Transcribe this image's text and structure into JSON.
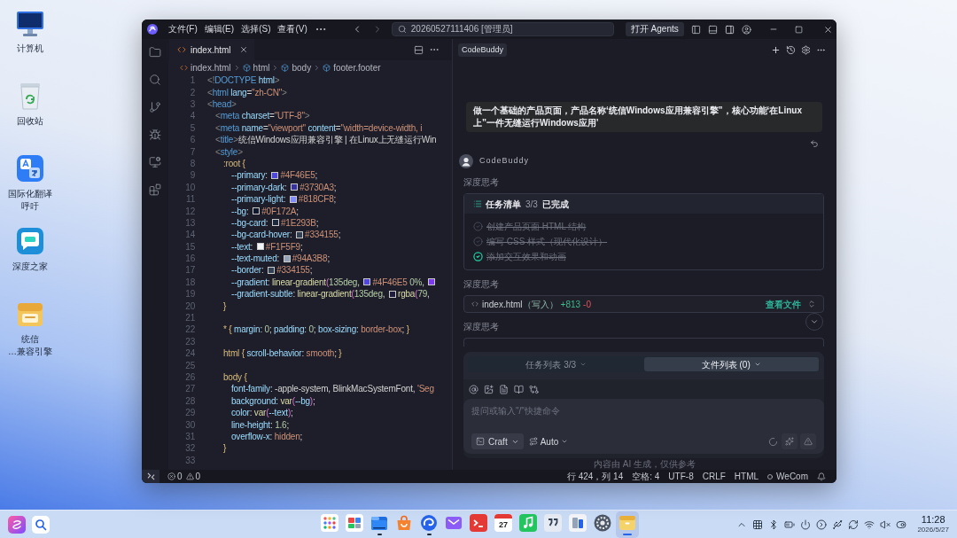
{
  "desktop_icons": [
    {
      "kind": "computer",
      "label_lines": [
        "计算机"
      ]
    },
    {
      "kind": "trash",
      "label_lines": [
        "回收站"
      ]
    },
    {
      "kind": "translator",
      "label_lines": [
        "国际化翻译",
        "呼吁"
      ]
    },
    {
      "kind": "home",
      "label_lines": [
        "深度之家"
      ]
    },
    {
      "kind": "package",
      "label_lines": [
        "统信",
        "…兼容引擎"
      ]
    }
  ],
  "window": {
    "menu": [
      "文件(F)",
      "编辑(E)",
      "选择(S)",
      "查看(V)"
    ],
    "command_center": "20260527111406 [管理员]",
    "agents_button": "打开 Agents"
  },
  "editor": {
    "tabs": [
      {
        "label": "index.html",
        "selected": true
      }
    ],
    "breadcrumb": [
      {
        "kind": "file",
        "label": "index.html"
      },
      {
        "kind": "symbol",
        "label": "html"
      },
      {
        "kind": "symbol",
        "label": "body"
      },
      {
        "kind": "symbol",
        "label": "footer.footer"
      }
    ],
    "lines": [
      {
        "number": "1",
        "tokens": [
          {
            "kind": "punct",
            "text": "<!"
          },
          {
            "kind": "tag",
            "text": "DOCTYPE"
          },
          {
            "kind": "attr",
            "text": " html"
          },
          {
            "kind": "punct",
            "text": ">"
          }
        ]
      },
      {
        "number": "2",
        "tokens": [
          {
            "kind": "punct",
            "text": "<"
          },
          {
            "kind": "tag",
            "text": "html"
          },
          {
            "kind": "attr",
            "text": " lang"
          },
          {
            "kind": "plain",
            "text": "="
          },
          {
            "kind": "string",
            "text": "\"zh-CN\""
          },
          {
            "kind": "punct",
            "text": ">"
          }
        ]
      },
      {
        "number": "3",
        "tokens": [
          {
            "kind": "punct",
            "text": "<"
          },
          {
            "kind": "tag",
            "text": "head"
          },
          {
            "kind": "punct",
            "text": ">"
          }
        ],
        "children": [
          {
            "number": "4",
            "tokens": [
              {
                "kind": "punct",
                "text": "<"
              },
              {
                "kind": "tag",
                "text": "meta"
              },
              {
                "kind": "attr",
                "text": " charset"
              },
              {
                "kind": "plain",
                "text": "="
              },
              {
                "kind": "string",
                "text": "\"UTF-8\""
              },
              {
                "kind": "punct",
                "text": ">"
              }
            ]
          },
          {
            "number": "5",
            "tokens": [
              {
                "kind": "punct",
                "text": "<"
              },
              {
                "kind": "tag",
                "text": "meta"
              },
              {
                "kind": "attr",
                "text": " name"
              },
              {
                "kind": "plain",
                "text": "="
              },
              {
                "kind": "string",
                "text": "\"viewport\""
              },
              {
                "kind": "attr",
                "text": " content"
              },
              {
                "kind": "plain",
                "text": "="
              },
              {
                "kind": "string",
                "text": "\"width=device-width, i"
              }
            ]
          },
          {
            "number": "6",
            "tokens": [
              {
                "kind": "punct",
                "text": "<"
              },
              {
                "kind": "tag",
                "text": "title"
              },
              {
                "kind": "punct",
                "text": ">"
              },
              {
                "kind": "plain",
                "text": "统信Windows应用兼容引擎 | 在Linux上无缝运行Win"
              }
            ]
          },
          {
            "number": "7",
            "tokens": [
              {
                "kind": "punct",
                "text": "<"
              },
              {
                "kind": "tag",
                "text": "style"
              },
              {
                "kind": "punct",
                "text": ">"
              }
            ],
            "children": [
              {
                "number": "8",
                "tokens": [
                  {
                    "kind": "selector",
                    "text": ":root"
                  },
                  {
                    "kind": "brace",
                    "text": " {"
                  }
                ],
                "children": [
                  {
                    "number": "9",
                    "tokens": [
                      {
                        "kind": "prop",
                        "text": "--primary"
                      },
                      {
                        "kind": "plain",
                        "text": ": "
                      },
                      {
                        "kind": "swatch",
                        "color": "#4f46e5"
                      },
                      {
                        "kind": "value",
                        "text": "#4F46E5"
                      },
                      {
                        "kind": "plain",
                        "text": ";"
                      }
                    ]
                  },
                  {
                    "number": "10",
                    "tokens": [
                      {
                        "kind": "prop",
                        "text": "--primary-dark"
                      },
                      {
                        "kind": "plain",
                        "text": ": "
                      },
                      {
                        "kind": "swatch",
                        "color": "#3730a3"
                      },
                      {
                        "kind": "value",
                        "text": "#3730A3"
                      },
                      {
                        "kind": "plain",
                        "text": ";"
                      }
                    ]
                  },
                  {
                    "number": "11",
                    "tokens": [
                      {
                        "kind": "prop",
                        "text": "--primary-light"
                      },
                      {
                        "kind": "plain",
                        "text": ": "
                      },
                      {
                        "kind": "swatch",
                        "color": "#818cf8"
                      },
                      {
                        "kind": "value",
                        "text": "#818CF8"
                      },
                      {
                        "kind": "plain",
                        "text": ";"
                      }
                    ]
                  },
                  {
                    "number": "12",
                    "tokens": [
                      {
                        "kind": "prop",
                        "text": "--bg"
                      },
                      {
                        "kind": "plain",
                        "text": ": "
                      },
                      {
                        "kind": "swatch",
                        "color": "#0f172a"
                      },
                      {
                        "kind": "value",
                        "text": "#0F172A"
                      },
                      {
                        "kind": "plain",
                        "text": ";"
                      }
                    ]
                  },
                  {
                    "number": "13",
                    "tokens": [
                      {
                        "kind": "prop",
                        "text": "--bg-card"
                      },
                      {
                        "kind": "plain",
                        "text": ": "
                      },
                      {
                        "kind": "swatch",
                        "color": "#1e293b"
                      },
                      {
                        "kind": "value",
                        "text": "#1E293B"
                      },
                      {
                        "kind": "plain",
                        "text": ";"
                      }
                    ]
                  },
                  {
                    "number": "14",
                    "tokens": [
                      {
                        "kind": "prop",
                        "text": "--bg-card-hover"
                      },
                      {
                        "kind": "plain",
                        "text": ": "
                      },
                      {
                        "kind": "swatch",
                        "color": "#334155"
                      },
                      {
                        "kind": "value",
                        "text": "#334155"
                      },
                      {
                        "kind": "plain",
                        "text": ";"
                      }
                    ]
                  },
                  {
                    "number": "15",
                    "tokens": [
                      {
                        "kind": "prop",
                        "text": "--text"
                      },
                      {
                        "kind": "plain",
                        "text": ": "
                      },
                      {
                        "kind": "swatch",
                        "color": "#f1f5f9"
                      },
                      {
                        "kind": "value",
                        "text": "#F1F5F9"
                      },
                      {
                        "kind": "plain",
                        "text": ";"
                      }
                    ]
                  },
                  {
                    "number": "16",
                    "tokens": [
                      {
                        "kind": "prop",
                        "text": "--text-muted"
                      },
                      {
                        "kind": "plain",
                        "text": ": "
                      },
                      {
                        "kind": "swatch",
                        "color": "#94a3b8"
                      },
                      {
                        "kind": "value",
                        "text": "#94A3B8"
                      },
                      {
                        "kind": "plain",
                        "text": ";"
                      }
                    ]
                  },
                  {
                    "number": "17",
                    "tokens": [
                      {
                        "kind": "prop",
                        "text": "--border"
                      },
                      {
                        "kind": "plain",
                        "text": ": "
                      },
                      {
                        "kind": "swatch",
                        "color": "#334155"
                      },
                      {
                        "kind": "value",
                        "text": "#334155"
                      },
                      {
                        "kind": "plain",
                        "text": ";"
                      }
                    ]
                  },
                  {
                    "number": "18",
                    "tokens": [
                      {
                        "kind": "prop",
                        "text": "--gradient"
                      },
                      {
                        "kind": "plain",
                        "text": ": "
                      },
                      {
                        "kind": "func",
                        "text": "linear-gradient"
                      },
                      {
                        "kind": "paren",
                        "text": "("
                      },
                      {
                        "kind": "number",
                        "text": "135deg"
                      },
                      {
                        "kind": "plain",
                        "text": ", "
                      },
                      {
                        "kind": "swatch",
                        "color": "#4f46e5"
                      },
                      {
                        "kind": "value",
                        "text": "#4F46E5"
                      },
                      {
                        "kind": "number",
                        "text": " 0%"
                      },
                      {
                        "kind": "plain",
                        "text": ", "
                      },
                      {
                        "kind": "swatch",
                        "color": "#7c3aed"
                      }
                    ]
                  },
                  {
                    "number": "19",
                    "tokens": [
                      {
                        "kind": "prop",
                        "text": "--gradient-subtle"
                      },
                      {
                        "kind": "plain",
                        "text": ": "
                      },
                      {
                        "kind": "func",
                        "text": "linear-gradient"
                      },
                      {
                        "kind": "paren",
                        "text": "("
                      },
                      {
                        "kind": "number",
                        "text": "135deg"
                      },
                      {
                        "kind": "plain",
                        "text": ", "
                      },
                      {
                        "kind": "swatch",
                        "color": "#1f1d3b"
                      },
                      {
                        "kind": "func",
                        "text": "rgba"
                      },
                      {
                        "kind": "paren",
                        "text": "("
                      },
                      {
                        "kind": "number",
                        "text": "79"
                      },
                      {
                        "kind": "plain",
                        "text": ","
                      }
                    ]
                  }
                ]
              },
              {
                "number": "20",
                "tokens": [
                  {
                    "kind": "brace",
                    "text": "}"
                  }
                ]
              },
              {
                "number": "21"
              },
              {
                "number": "22",
                "tokens": [
                  {
                    "kind": "selector",
                    "text": "*"
                  },
                  {
                    "kind": "brace",
                    "text": " {"
                  },
                  {
                    "kind": "prop",
                    "text": " margin"
                  },
                  {
                    "kind": "plain",
                    "text": ": "
                  },
                  {
                    "kind": "number",
                    "text": "0"
                  },
                  {
                    "kind": "plain",
                    "text": "; "
                  },
                  {
                    "kind": "prop",
                    "text": "padding"
                  },
                  {
                    "kind": "plain",
                    "text": ": "
                  },
                  {
                    "kind": "number",
                    "text": "0"
                  },
                  {
                    "kind": "plain",
                    "text": "; "
                  },
                  {
                    "kind": "prop",
                    "text": "box-sizing"
                  },
                  {
                    "kind": "plain",
                    "text": ": "
                  },
                  {
                    "kind": "value",
                    "text": "border-box"
                  },
                  {
                    "kind": "plain",
                    "text": "; "
                  },
                  {
                    "kind": "brace",
                    "text": "}"
                  }
                ]
              },
              {
                "number": "23"
              },
              {
                "number": "24",
                "tokens": [
                  {
                    "kind": "selector",
                    "text": "html"
                  },
                  {
                    "kind": "brace",
                    "text": " {"
                  },
                  {
                    "kind": "prop",
                    "text": " scroll-behavior"
                  },
                  {
                    "kind": "plain",
                    "text": ": "
                  },
                  {
                    "kind": "value",
                    "text": "smooth"
                  },
                  {
                    "kind": "plain",
                    "text": "; "
                  },
                  {
                    "kind": "brace",
                    "text": "}"
                  }
                ]
              },
              {
                "number": "25"
              },
              {
                "number": "26",
                "tokens": [
                  {
                    "kind": "selector",
                    "text": "body"
                  },
                  {
                    "kind": "brace",
                    "text": " {"
                  }
                ],
                "children": [
                  {
                    "number": "27",
                    "tokens": [
                      {
                        "kind": "prop",
                        "text": "font-family"
                      },
                      {
                        "kind": "plain",
                        "text": ": -apple-system, BlinkMacSystemFont, "
                      },
                      {
                        "kind": "string",
                        "text": "'Seg"
                      }
                    ]
                  },
                  {
                    "number": "28",
                    "tokens": [
                      {
                        "kind": "prop",
                        "text": "background"
                      },
                      {
                        "kind": "plain",
                        "text": ": "
                      },
                      {
                        "kind": "func",
                        "text": "var"
                      },
                      {
                        "kind": "paren",
                        "text": "("
                      },
                      {
                        "kind": "prop",
                        "text": "--bg"
                      },
                      {
                        "kind": "paren",
                        "text": ")"
                      },
                      {
                        "kind": "plain",
                        "text": ";"
                      }
                    ]
                  },
                  {
                    "number": "29",
                    "tokens": [
                      {
                        "kind": "prop",
                        "text": "color"
                      },
                      {
                        "kind": "plain",
                        "text": ": "
                      },
                      {
                        "kind": "func",
                        "text": "var"
                      },
                      {
                        "kind": "paren",
                        "text": "("
                      },
                      {
                        "kind": "prop",
                        "text": "--text"
                      },
                      {
                        "kind": "paren",
                        "text": ")"
                      },
                      {
                        "kind": "plain",
                        "text": ";"
                      }
                    ]
                  },
                  {
                    "number": "30",
                    "tokens": [
                      {
                        "kind": "prop",
                        "text": "line-height"
                      },
                      {
                        "kind": "plain",
                        "text": ": "
                      },
                      {
                        "kind": "number",
                        "text": "1.6"
                      },
                      {
                        "kind": "plain",
                        "text": ";"
                      }
                    ]
                  },
                  {
                    "number": "31",
                    "tokens": [
                      {
                        "kind": "prop",
                        "text": "overflow-x"
                      },
                      {
                        "kind": "plain",
                        "text": ": "
                      },
                      {
                        "kind": "value",
                        "text": "hidden"
                      },
                      {
                        "kind": "plain",
                        "text": ";"
                      }
                    ]
                  }
                ]
              },
              {
                "number": "32",
                "tokens": [
                  {
                    "kind": "brace",
                    "text": "}"
                  }
                ]
              },
              {
                "number": "33"
              }
            ]
          }
        ]
      }
    ]
  },
  "assistant": {
    "header_chip": "CodeBuddy",
    "user_message": "做一个基础的产品页面，产品名称‘统信Windows应用兼容引擎”，核心功能‘在Linux上”一件无缝运行Windows应用’",
    "bot_name": "CodeBuddy",
    "blocks": [
      {
        "kind": "thinking",
        "label": "深度思考"
      },
      {
        "kind": "task_list",
        "title": "任务清单",
        "count": "3/3",
        "status": "已完成",
        "items": [
          {
            "text": "创建产品页面 HTML 结构",
            "done": true,
            "highlighted": false
          },
          {
            "text": "编写 CSS 样式（现代化设计）",
            "done": true,
            "highlighted": false
          },
          {
            "text": "添加交互效果和动画",
            "done": true,
            "highlighted": true
          }
        ]
      },
      {
        "kind": "thinking",
        "label": "深度思考"
      },
      {
        "kind": "file_change",
        "file": "index.html",
        "action": "（写入）",
        "added": "+813",
        "removed": "-0",
        "link": "查看文件"
      },
      {
        "kind": "thinking",
        "label": "深度思考"
      }
    ],
    "bottom_tabs": [
      {
        "label": "任务列表 3/3",
        "selected": false
      },
      {
        "label": "文件列表 (0)",
        "selected": true
      }
    ],
    "composer": {
      "placeholder": "提问或输入\"/\"快捷命令",
      "mode": "Craft",
      "model": "Auto"
    },
    "disclaimer": "内容由 AI 生成，仅供参考"
  },
  "status_bar": {
    "errors": "0",
    "warnings": "0",
    "cursor": "行 424，列 14",
    "indentation": "空格: 4",
    "encoding": "UTF-8",
    "line_ending": "CRLF",
    "language": "HTML",
    "account": "WeCom"
  },
  "taskbar": {
    "apps": [
      {
        "kind": "launcher",
        "running": false,
        "selected": false
      },
      {
        "kind": "multitask",
        "running": false,
        "selected": false
      },
      {
        "kind": "files",
        "running": true,
        "selected": false
      },
      {
        "kind": "store",
        "running": false,
        "selected": false
      },
      {
        "kind": "browser",
        "running": true,
        "selected": false
      },
      {
        "kind": "mail",
        "running": false,
        "selected": false
      },
      {
        "kind": "terminal",
        "running": false,
        "selected": false
      },
      {
        "kind": "calendar",
        "text": "27",
        "running": false,
        "selected": false
      },
      {
        "kind": "music",
        "running": false,
        "selected": false
      },
      {
        "kind": "notes",
        "running": false,
        "selected": false
      },
      {
        "kind": "device",
        "running": false,
        "selected": false
      },
      {
        "kind": "settings",
        "running": false,
        "selected": false
      },
      {
        "kind": "archive",
        "running": true,
        "selected": true
      }
    ],
    "time": "11:28",
    "date": "2026/5/27"
  }
}
